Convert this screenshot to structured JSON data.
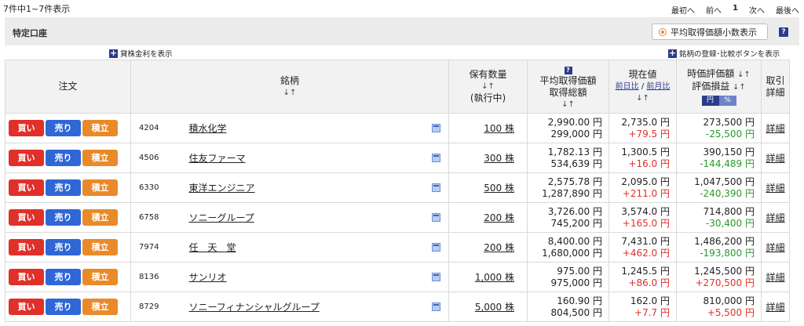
{
  "summary": {
    "count_text": "7件中1~7件表示"
  },
  "pager": {
    "first": "最初へ",
    "prev": "前へ",
    "current": "1",
    "next": "次へ",
    "last": "最後へ"
  },
  "account": {
    "title": "特定口座",
    "avg_decimal_button": "平均取得価額小数表示",
    "help": "?"
  },
  "links": {
    "lending": "貸株金利を表示",
    "register": "銘柄の登録･比較ボタンを表示",
    "plus": "+"
  },
  "headers": {
    "order": "注文",
    "stock": "銘柄",
    "sort": "↓↑",
    "qty": "保有数量",
    "qty_sub": "(執行中)",
    "avg_line1": "平均取得価額",
    "avg_line2": "取得総額",
    "current": "現在値",
    "prev_day_ratio": "前日比",
    "sep": "/",
    "prev_month_ratio": "前月比",
    "valuation": "時価評価額",
    "pl": "評価損益",
    "toggle_yen": "円",
    "toggle_pct": "%",
    "detail_line1": "取引",
    "detail_line2": "詳細",
    "qhelp": "?"
  },
  "buttons": {
    "buy": "買い",
    "sell": "売り",
    "tsumitate": "積立",
    "detail": "詳細"
  },
  "holdings": [
    {
      "code": "4204",
      "name": "積水化学",
      "qty": "100 株",
      "avg": "2,990.00 円",
      "total": "299,000 円",
      "price": "2,735.0 円",
      "change": "+79.5 円",
      "value": "273,500 円",
      "pl": "-25,500 円"
    },
    {
      "code": "4506",
      "name": "住友ファーマ",
      "qty": "300 株",
      "avg": "1,782.13 円",
      "total": "534,639 円",
      "price": "1,300.5 円",
      "change": "+16.0 円",
      "value": "390,150 円",
      "pl": "-144,489 円"
    },
    {
      "code": "6330",
      "name": "東洋エンジニア",
      "qty": "500 株",
      "avg": "2,575.78 円",
      "total": "1,287,890 円",
      "price": "2,095.0 円",
      "change": "+211.0 円",
      "value": "1,047,500 円",
      "pl": "-240,390 円"
    },
    {
      "code": "6758",
      "name": "ソニーグループ",
      "qty": "200 株",
      "avg": "3,726.00 円",
      "total": "745,200 円",
      "price": "3,574.0 円",
      "change": "+165.0 円",
      "value": "714,800 円",
      "pl": "-30,400 円"
    },
    {
      "code": "7974",
      "name": "任　天　堂",
      "qty": "200 株",
      "avg": "8,400.00 円",
      "total": "1,680,000 円",
      "price": "7,431.0 円",
      "change": "+462.0 円",
      "value": "1,486,200 円",
      "pl": "-193,800 円"
    },
    {
      "code": "8136",
      "name": "サンリオ",
      "qty": "1,000 株",
      "avg": "975.00 円",
      "total": "975,000 円",
      "price": "1,245.5 円",
      "change": "+86.0 円",
      "value": "1,245,500 円",
      "pl": "+270,500 円"
    },
    {
      "code": "8729",
      "name": "ソニーフィナンシャルグループ",
      "qty": "5,000 株",
      "avg": "160.90 円",
      "total": "804,500 円",
      "price": "162.0 円",
      "change": "+7.7 円",
      "value": "810,000 円",
      "pl": "+5,500 円"
    }
  ],
  "colors": {
    "buy": "#e0302a",
    "sell": "#2f67d6",
    "tsumitate": "#e98a2a",
    "positive": "#e0302a",
    "negative": "#2a9a2a"
  }
}
